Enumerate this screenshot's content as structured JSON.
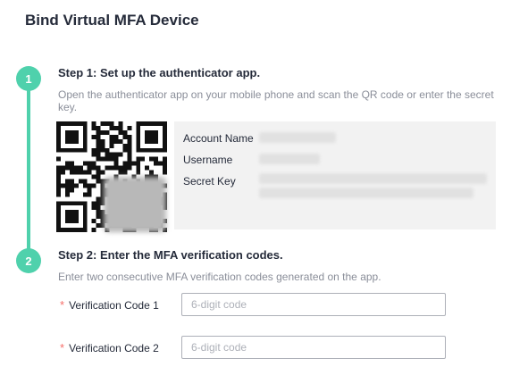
{
  "page": {
    "title": "Bind Virtual MFA Device"
  },
  "colors": {
    "accent": "#4fd1ac",
    "required": "#f66f6a",
    "panel": "#f2f2f2"
  },
  "steps": [
    {
      "number": "1",
      "title": "Step 1: Set up the authenticator app.",
      "description": "Open the authenticator app on your mobile phone and scan the QR code or enter the secret key."
    },
    {
      "number": "2",
      "title": "Step 2: Enter the MFA verification codes.",
      "description": "Enter two consecutive MFA verification codes generated on the app."
    }
  ],
  "account_info": {
    "account_name_label": "Account Name",
    "username_label": "Username",
    "secret_key_label": "Secret Key"
  },
  "form": {
    "code1": {
      "label": "Verification Code 1",
      "placeholder": "6-digit code",
      "value": ""
    },
    "code2": {
      "label": "Verification Code 2",
      "placeholder": "6-digit code",
      "value": ""
    }
  }
}
